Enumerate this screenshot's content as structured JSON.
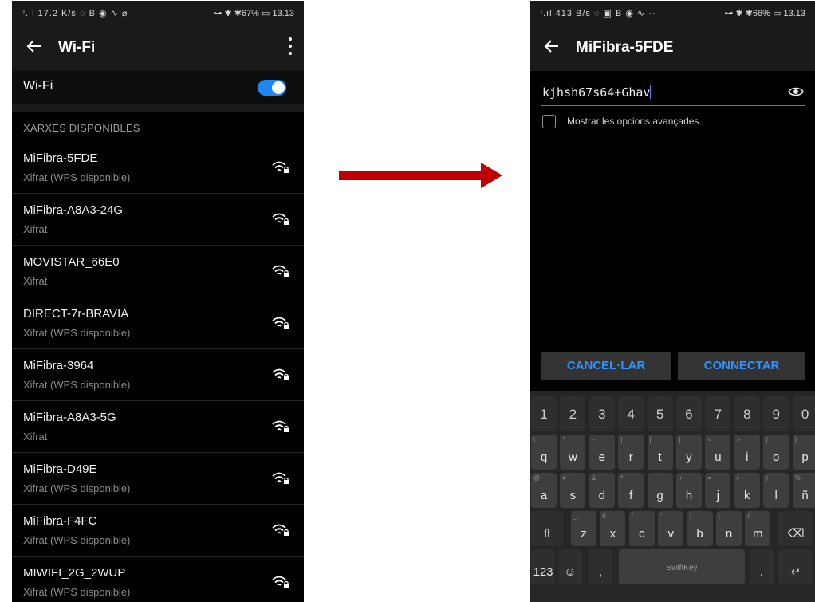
{
  "left_screen": {
    "status": {
      "left": "ⁱ.ıl 17.2 K/s ◌ B ◉ ∿ ⌀",
      "right": "⊶ ✱ ✱67% ▭ 13.13"
    },
    "title": "Wi-Fi",
    "wifi_label": "Wi-Fi",
    "wifi_enabled": true,
    "section_header": "XARXES DISPONIBLES",
    "networks": [
      {
        "name": "MiFibra-5FDE",
        "security": "Xifrat (WPS disponible)"
      },
      {
        "name": "MiFibra-A8A3-24G",
        "security": "Xifrat"
      },
      {
        "name": "MOVISTAR_66E0",
        "security": "Xifrat"
      },
      {
        "name": "DIRECT-7r-BRAVIA",
        "security": "Xifrat (WPS disponible)"
      },
      {
        "name": "MiFibra-3964",
        "security": "Xifrat (WPS disponible)"
      },
      {
        "name": "MiFibra-A8A3-5G",
        "security": "Xifrat"
      },
      {
        "name": "MiFibra-D49E",
        "security": "Xifrat (WPS disponible)"
      },
      {
        "name": "MiFibra-F4FC",
        "security": "Xifrat (WPS disponible)"
      },
      {
        "name": "MIWIFI_2G_2WUP",
        "security": "Xifrat (WPS disponible)"
      }
    ]
  },
  "right_screen": {
    "status": {
      "left": "ⁱ.ıl 413 B/s ◌ ▣ B ◉ ∿ ··",
      "right": "⊶ ✱ ✱66% ▭ 13.13"
    },
    "title": "MiFibra-5FDE",
    "password_value": "kjhsh67s64+Ghav",
    "advanced_label": "Mostrar les opcions avançades",
    "cancel_label": "CANCEL·LAR",
    "connect_label": "CONNECTAR",
    "keyboard": {
      "numbers": [
        "1",
        "2",
        "3",
        "4",
        "5",
        "6",
        "7",
        "8",
        "9",
        "0"
      ],
      "row1": [
        {
          "k": "q",
          "a": "\\"
        },
        {
          "k": "w",
          "a": "^"
        },
        {
          "k": "e",
          "a": "~"
        },
        {
          "k": "r",
          "a": "|"
        },
        {
          "k": "t",
          "a": "["
        },
        {
          "k": "y",
          "a": "]"
        },
        {
          "k": "u",
          "a": "<"
        },
        {
          "k": "i",
          "a": ">"
        },
        {
          "k": "o",
          "a": "{"
        },
        {
          "k": "p",
          "a": "}"
        }
      ],
      "row2": [
        {
          "k": "a",
          "a": "@"
        },
        {
          "k": "s",
          "a": "#"
        },
        {
          "k": "d",
          "a": "&"
        },
        {
          "k": "f",
          "a": "*"
        },
        {
          "k": "g",
          "a": "-"
        },
        {
          "k": "h",
          "a": "+"
        },
        {
          "k": "j",
          "a": "="
        },
        {
          "k": "k",
          "a": "("
        },
        {
          "k": "l",
          "a": ")"
        },
        {
          "k": "ñ",
          "a": "%"
        }
      ],
      "row3": [
        {
          "k": "z",
          "a": "_"
        },
        {
          "k": "x",
          "a": "€"
        },
        {
          "k": "c",
          "a": "\""
        },
        {
          "k": "v",
          "a": "'"
        },
        {
          "k": "b",
          "a": ":"
        },
        {
          "k": "n",
          "a": ";"
        },
        {
          "k": "m",
          "a": "/"
        }
      ],
      "shift": "⇧",
      "backspace": "⌫",
      "symbols": "123",
      "emoji": "☺",
      "comma": ",",
      "space": "SwiftKey",
      "period": ".",
      "enter": "↵"
    }
  },
  "colors": {
    "accent_blue": "#1e86f0",
    "arrow_red": "#c00000",
    "button_text": "#2f92ff"
  }
}
